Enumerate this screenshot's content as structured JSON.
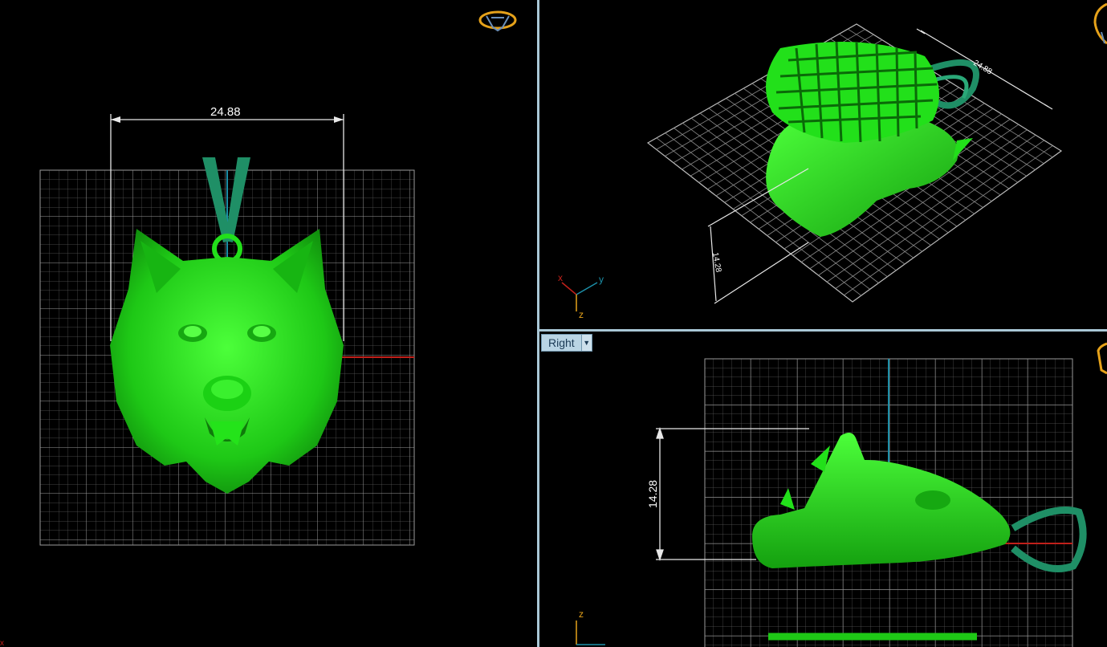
{
  "viewports": {
    "front": {
      "dimension_label": "24.88"
    },
    "perspective": {
      "dimension_width": "24.88",
      "dimension_height": "14.28",
      "axis_x": "x",
      "axis_y": "y",
      "axis_z": "z"
    },
    "right": {
      "view_name": "Right",
      "dimension_height": "14.28",
      "axis_z": "z"
    }
  },
  "icons": [
    "view-cube-icon",
    "dropdown-arrow-icon"
  ],
  "colors": {
    "model": "#22e01a",
    "bail": "#1f8f66",
    "grid": "#8a8a8a",
    "axis_red": "#c0201a",
    "axis_cyan": "#1c8fa8",
    "divider": "#a9c7d6"
  }
}
